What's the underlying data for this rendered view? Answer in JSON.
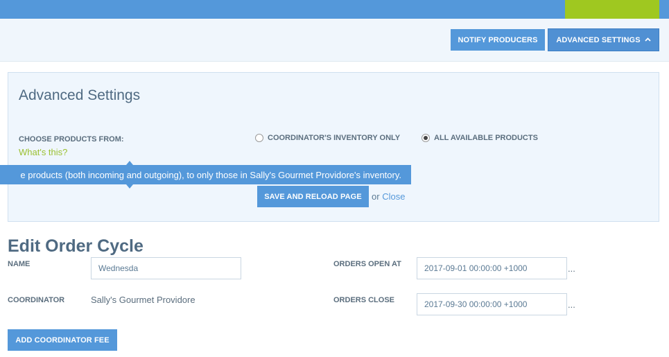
{
  "header": {
    "notify_label": "NOTIFY PRODUCERS",
    "advanced_label": "ADVANCED SETTINGS",
    "advanced_icon": "chevron-up-icon"
  },
  "advanced": {
    "title": "Advanced Settings",
    "choose_label": "CHOOSE PRODUCTS FROM:",
    "whats_this": "What's this?",
    "options": [
      {
        "label": "COORDINATOR'S INVENTORY ONLY",
        "selected": false
      },
      {
        "label": "ALL AVAILABLE PRODUCTS",
        "selected": true
      }
    ],
    "tooltip": "e products (both incoming and outgoing), to only those in Sally's Gourmet Providore's inventory.",
    "save_label": "SAVE AND RELOAD PAGE",
    "or_text": "or",
    "close_label": "Close"
  },
  "edit": {
    "title": "Edit Order Cycle",
    "name_label": "NAME",
    "name_value": "Wednesda",
    "coordinator_label": "COORDINATOR",
    "coordinator_value": "Sally's Gourmet Providore",
    "orders_open_label": "ORDERS OPEN AT",
    "orders_open_value": "2017-09-01 00:00:00 +1000",
    "orders_close_label": "ORDERS CLOSE",
    "orders_close_value": "2017-09-30 00:00:00 +1000",
    "ellipsis": "...",
    "add_fee_label": "ADD COORDINATOR FEE"
  },
  "colors": {
    "primary": "#5498da",
    "accent_green": "#9fc820",
    "panel_bg": "#eff6fd"
  }
}
